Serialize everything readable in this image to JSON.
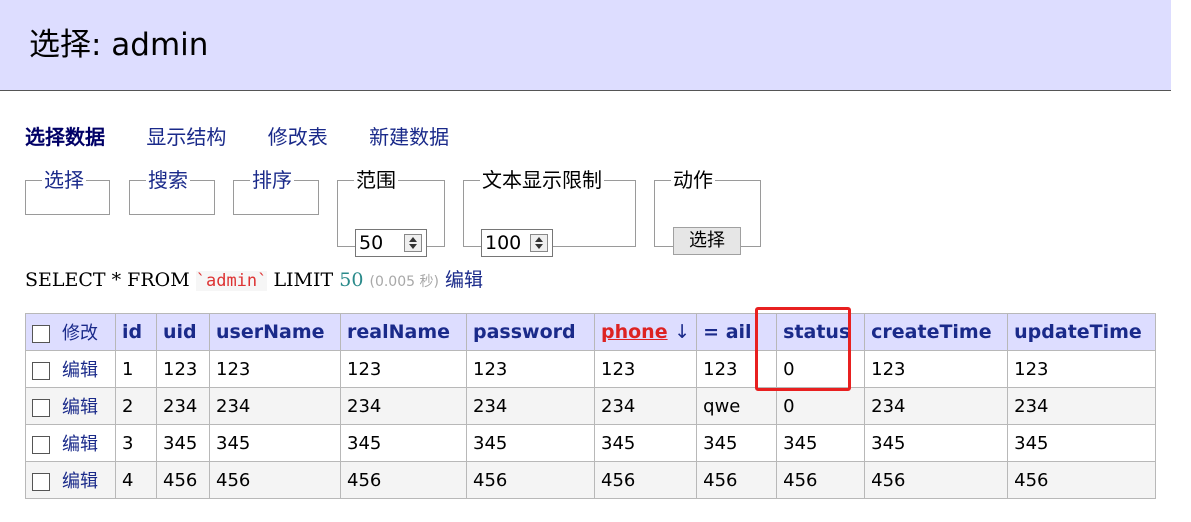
{
  "header": {
    "title": "选择: admin"
  },
  "nav": [
    {
      "label": "选择数据",
      "active": true
    },
    {
      "label": "显示结构"
    },
    {
      "label": "修改表"
    },
    {
      "label": "新建数据"
    }
  ],
  "controls": {
    "select_legend": "选择",
    "search_legend": "搜索",
    "sort_legend": "排序",
    "range_legend": "范围",
    "range_value": "50",
    "text_limit_legend": "文本显示限制",
    "text_limit_value": "100",
    "action_legend": "动作",
    "action_button": "选择"
  },
  "sql": {
    "select": "SELECT * FROM",
    "table": "`admin`",
    "limit": "LIMIT",
    "limit_value": "50",
    "time": "(0.005 秒)",
    "edit_link": "编辑"
  },
  "table": {
    "modify_header": "修改",
    "columns": [
      "id",
      "uid",
      "userName",
      "realName",
      "password",
      "phone",
      "↓",
      "=",
      "ail",
      "status",
      "createTime",
      "updateTime"
    ],
    "edit_label": "编辑",
    "rows": [
      [
        "1",
        "123",
        "123",
        "123",
        "123",
        "123",
        "123",
        "0",
        "123",
        "123"
      ],
      [
        "2",
        "234",
        "234",
        "234",
        "234",
        "234",
        "qwe",
        "0",
        "234",
        "234"
      ],
      [
        "3",
        "345",
        "345",
        "345",
        "345",
        "345",
        "345",
        "345",
        "345",
        "345"
      ],
      [
        "4",
        "456",
        "456",
        "456",
        "456",
        "456",
        "456",
        "456",
        "456",
        "456"
      ]
    ]
  },
  "colors": {
    "header_bg": "#ddddff",
    "link": "#1a2a8a",
    "sorted": "#dd2222",
    "highlight": "#e82020"
  }
}
